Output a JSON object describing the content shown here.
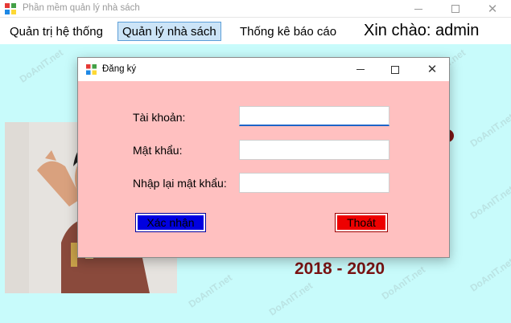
{
  "main_window": {
    "title": "Phần mềm quản lý nhà sách",
    "controls": {
      "minimize": "minimize",
      "maximize": "maximize",
      "close": "close"
    }
  },
  "menu": {
    "items": [
      {
        "label": "Quản trị hệ thống",
        "active": false
      },
      {
        "label": "Quản lý nhà sách",
        "active": true
      },
      {
        "label": "Thống kê báo cáo",
        "active": false
      }
    ],
    "greeting": "Xin chào: admin"
  },
  "background": {
    "years": "2018 - 2020",
    "watermark": "DoAnIT.net"
  },
  "dialog": {
    "title": "Đăng ký",
    "fields": [
      {
        "label": "Tài khoản:",
        "value": ""
      },
      {
        "label": "Mật khẩu:",
        "value": ""
      },
      {
        "label": "Nhập lại mật khẩu:",
        "value": ""
      }
    ],
    "confirm_label": "Xác nhận",
    "exit_label": "Thoát"
  },
  "colors": {
    "background": "#c8fbfb",
    "dialog_bg": "#ffc0c0",
    "confirm_button": "#0000e0",
    "exit_button": "#ee0000",
    "years_text": "#7a1414",
    "menu_active": "#cce4f7"
  }
}
